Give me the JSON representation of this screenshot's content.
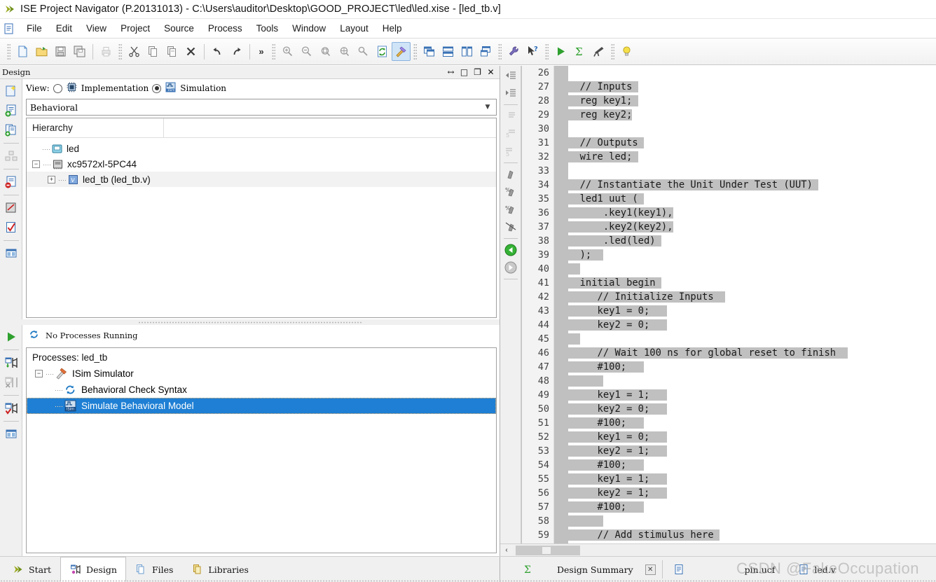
{
  "window": {
    "title": "ISE Project Navigator (P.20131013) - C:\\Users\\auditor\\Desktop\\GOOD_PROJECT\\led\\led.xise - [led_tb.v]",
    "app_icon": "green-arrow-icon"
  },
  "menu": {
    "items": [
      "File",
      "Edit",
      "View",
      "Project",
      "Source",
      "Process",
      "Tools",
      "Window",
      "Layout",
      "Help"
    ]
  },
  "toolbar": {
    "chevron": "»",
    "groups": [
      {
        "buttons": [
          {
            "name": "new-file-icon",
            "label": "New"
          },
          {
            "name": "open-folder-icon",
            "label": "Open"
          },
          {
            "name": "save-icon",
            "label": "Save"
          },
          {
            "name": "save-all-icon",
            "label": "Save All"
          }
        ]
      },
      {
        "buttons": [
          {
            "name": "print-icon",
            "label": "Print"
          }
        ]
      },
      {
        "buttons": [
          {
            "name": "cut-scissors-icon",
            "label": "Cut"
          },
          {
            "name": "copy-icon",
            "label": "Copy"
          },
          {
            "name": "paste-icon",
            "label": "Paste"
          },
          {
            "name": "delete-x-icon",
            "label": "Delete"
          }
        ]
      },
      {
        "buttons": [
          {
            "name": "undo-icon",
            "label": "Undo"
          },
          {
            "name": "redo-icon",
            "label": "Redo"
          }
        ]
      },
      {
        "buttons": [
          {
            "name": "zoom-in-icon",
            "label": "Zoom In"
          },
          {
            "name": "zoom-out-icon",
            "label": "Zoom Out"
          },
          {
            "name": "zoom-fit-icon",
            "label": "Zoom To Fit"
          },
          {
            "name": "zoom-selection-icon",
            "label": "Zoom Selection"
          },
          {
            "name": "find-key-icon",
            "label": "Find"
          },
          {
            "name": "refresh-icon",
            "label": "Refresh"
          },
          {
            "name": "build-hammer-icon",
            "label": "Implement Design"
          }
        ]
      },
      {
        "buttons": [
          {
            "name": "cascade-windows-icon",
            "label": "Cascade"
          },
          {
            "name": "tile-horizontally-icon",
            "label": "Tile Horizontally"
          },
          {
            "name": "tile-vertically-icon",
            "label": "Tile Vertically"
          },
          {
            "name": "arrange-windows-icon",
            "label": "Arrange"
          }
        ]
      },
      {
        "buttons": [
          {
            "name": "wrench-settings-icon",
            "label": "Design Goals"
          },
          {
            "name": "context-help-icon",
            "label": "What's This Help"
          }
        ]
      },
      {
        "buttons": [
          {
            "name": "run-play-icon",
            "label": "Run"
          },
          {
            "name": "summary-sigma-icon",
            "label": "Design Summary"
          },
          {
            "name": "telescope-icon",
            "label": "Analyze"
          }
        ]
      },
      {
        "buttons": [
          {
            "name": "lightbulb-tip-icon",
            "label": "Tip"
          }
        ]
      }
    ]
  },
  "design_panel": {
    "caption": "Design",
    "caption_buttons": [
      {
        "name": "dock-resize-icon",
        "glyph": "↔"
      },
      {
        "name": "maximize-icon",
        "glyph": "□"
      },
      {
        "name": "restore-icon",
        "glyph": "❐"
      },
      {
        "name": "close-icon",
        "glyph": "✕"
      }
    ],
    "side_tools": [
      {
        "name": "new-source-icon"
      },
      {
        "name": "add-source-icon"
      },
      {
        "name": "add-copy-source-icon"
      },
      {
        "name": "manage-configuration-icon"
      },
      {
        "name": "remove-source-icon"
      },
      {
        "name": "design-utilities-icon"
      },
      {
        "name": "check-syntax-icon"
      },
      {
        "name": "view-panel-icon"
      }
    ],
    "view_label": "View:",
    "view_options": [
      {
        "label": "Implementation",
        "selected": false,
        "icon": "chip-icon"
      },
      {
        "label": "Simulation",
        "selected": true,
        "icon": "simulation-icon"
      }
    ],
    "behavioral_combo": {
      "value": "Behavioral",
      "arrow": "▼"
    },
    "hierarchy": {
      "header": "Hierarchy",
      "nodes": [
        {
          "label": "led",
          "icon": "project-icon",
          "depth": 0,
          "toggle": "",
          "selected": false
        },
        {
          "label": "xc9572xl-5PC44",
          "icon": "device-chip-icon",
          "depth": 0,
          "toggle": "−",
          "selected": false
        },
        {
          "label": "led_tb (led_tb.v)",
          "icon": "verilog-file-icon",
          "depth": 1,
          "toggle": "+",
          "selected": true
        }
      ]
    }
  },
  "processes_panel": {
    "side_tools": [
      {
        "name": "run-process-icon"
      },
      {
        "name": "rerun-process-icon"
      },
      {
        "name": "stop-process-icon"
      },
      {
        "name": "rerun-all-icon"
      },
      {
        "name": "design-summary-panel-icon"
      }
    ],
    "status": {
      "icon": "refresh-processes-icon",
      "text": "No Processes Running"
    },
    "title": "Processes: led_tb",
    "tree": [
      {
        "label": "ISim Simulator",
        "icon": "isim-simulator-icon",
        "depth": 0,
        "toggle": "−",
        "selected": false
      },
      {
        "label": "Behavioral Check Syntax",
        "icon": "check-syntax-process-icon",
        "depth": 1,
        "toggle": "",
        "selected": false
      },
      {
        "label": "Simulate Behavioral Model",
        "icon": "isim-run-icon",
        "depth": 1,
        "toggle": "",
        "selected": true
      }
    ]
  },
  "editor": {
    "side_tools": [
      {
        "name": "outdent-icon"
      },
      {
        "name": "indent-icon"
      },
      {
        "name": "comment-icon"
      },
      {
        "name": "uncomment-icon"
      },
      {
        "name": "toggle-comment-icon"
      },
      {
        "name": "bookmark-icon"
      },
      {
        "name": "next-bookmark-icon"
      },
      {
        "name": "previous-bookmark-icon"
      },
      {
        "name": "clear-bookmarks-icon"
      },
      {
        "name": "back-arrow-icon"
      },
      {
        "name": "forward-arrow-icon"
      }
    ],
    "first_line_number": 26,
    "lines": [
      {
        "n": 26,
        "text": "",
        "hl_start": 0,
        "hl_len": 0
      },
      {
        "n": 27,
        "text": "  // Inputs",
        "hl_start": 0,
        "hl_len": 12
      },
      {
        "n": 28,
        "text": "  reg key1;",
        "hl_start": 0,
        "hl_len": 12
      },
      {
        "n": 29,
        "text": "  reg key2;",
        "hl_start": 0,
        "hl_len": 11
      },
      {
        "n": 30,
        "text": "",
        "hl_start": 0,
        "hl_len": 0
      },
      {
        "n": 31,
        "text": "  // Outputs",
        "hl_start": 0,
        "hl_len": 13
      },
      {
        "n": 32,
        "text": "  wire led;",
        "hl_start": 0,
        "hl_len": 12
      },
      {
        "n": 33,
        "text": "",
        "hl_start": 0,
        "hl_len": 0
      },
      {
        "n": 34,
        "text": "  // Instantiate the Unit Under Test (UUT)",
        "hl_start": 0,
        "hl_len": 43
      },
      {
        "n": 35,
        "text": "  led1 uut (",
        "hl_start": 0,
        "hl_len": 13
      },
      {
        "n": 36,
        "text": "      .key1(key1),",
        "hl_start": 0,
        "hl_len": 18
      },
      {
        "n": 37,
        "text": "      .key2(key2),",
        "hl_start": 0,
        "hl_len": 18
      },
      {
        "n": 38,
        "text": "      .led(led)",
        "hl_start": 0,
        "hl_len": 16
      },
      {
        "n": 39,
        "text": "  );",
        "hl_start": 0,
        "hl_len": 6
      },
      {
        "n": 40,
        "text": "",
        "hl_start": 0,
        "hl_len": 2
      },
      {
        "n": 41,
        "text": "  initial begin",
        "hl_start": 0,
        "hl_len": 16
      },
      {
        "n": 42,
        "text": "     // Initialize Inputs",
        "hl_start": 0,
        "hl_len": 27
      },
      {
        "n": 43,
        "text": "     key1 = 0;",
        "hl_start": 0,
        "hl_len": 17
      },
      {
        "n": 44,
        "text": "     key2 = 0;",
        "hl_start": 0,
        "hl_len": 17
      },
      {
        "n": 45,
        "text": "",
        "hl_start": 0,
        "hl_len": 2
      },
      {
        "n": 46,
        "text": "     // Wait 100 ns for global reset to finish",
        "hl_start": 0,
        "hl_len": 48
      },
      {
        "n": 47,
        "text": "     #100;",
        "hl_start": 0,
        "hl_len": 13
      },
      {
        "n": 48,
        "text": "",
        "hl_start": 0,
        "hl_len": 6
      },
      {
        "n": 49,
        "text": "     key1 = 1;",
        "hl_start": 0,
        "hl_len": 17
      },
      {
        "n": 50,
        "text": "     key2 = 0;",
        "hl_start": 0,
        "hl_len": 17
      },
      {
        "n": 51,
        "text": "     #100;",
        "hl_start": 0,
        "hl_len": 13
      },
      {
        "n": 52,
        "text": "     key1 = 0;",
        "hl_start": 0,
        "hl_len": 17
      },
      {
        "n": 53,
        "text": "     key2 = 1;",
        "hl_start": 0,
        "hl_len": 17
      },
      {
        "n": 54,
        "text": "     #100;",
        "hl_start": 0,
        "hl_len": 13
      },
      {
        "n": 55,
        "text": "     key1 = 1;",
        "hl_start": 0,
        "hl_len": 17
      },
      {
        "n": 56,
        "text": "     key2 = 1;",
        "hl_start": 0,
        "hl_len": 17
      },
      {
        "n": 57,
        "text": "     #100;",
        "hl_start": 0,
        "hl_len": 13
      },
      {
        "n": 58,
        "text": "",
        "hl_start": 0,
        "hl_len": 6
      },
      {
        "n": 59,
        "text": "     // Add stimulus here",
        "hl_start": 0,
        "hl_len": 26
      }
    ],
    "hscroll": {
      "left_arrow": "‹"
    }
  },
  "bottom_tabs": {
    "left": [
      {
        "label": "Start",
        "icon": "start-arrow-icon",
        "active": false
      },
      {
        "label": "Design",
        "icon": "design-tab-icon",
        "active": true
      },
      {
        "label": "Files",
        "icon": "files-tab-icon",
        "active": false
      },
      {
        "label": "Libraries",
        "icon": "libraries-tab-icon",
        "active": false
      }
    ],
    "right": [
      {
        "label": "Design Summary",
        "icon": "summary-sigma-icon",
        "closable": true,
        "close_glyph": "✕"
      },
      {
        "label": "pin.ucf",
        "icon": "ucf-file-icon",
        "closable": false
      },
      {
        "label": "led.v",
        "icon": "verilog-file-icon",
        "closable": false
      }
    ]
  },
  "watermark": "CSDN @FakeOccupation",
  "colors": {
    "selection_blue": "#1e7fd4",
    "code_highlight_gray": "#c0c0c0",
    "panel_gray": "#f0f0f0",
    "accent_green": "#2ea02e"
  }
}
